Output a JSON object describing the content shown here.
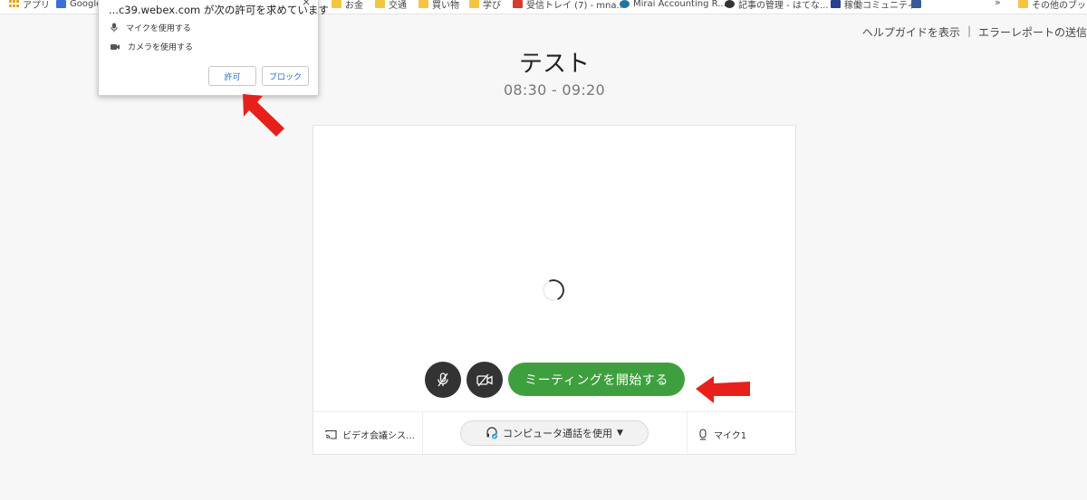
{
  "bookmarks": [
    {
      "label": "アプリ",
      "icon": "apps-icon"
    },
    {
      "label": "Google",
      "icon": "google-icon"
    },
    {
      "label": "お金",
      "icon": "folder-icon"
    },
    {
      "label": "交通",
      "icon": "folder-icon"
    },
    {
      "label": "買い物",
      "icon": "folder-icon"
    },
    {
      "label": "学び",
      "icon": "folder-icon"
    },
    {
      "label": "受信トレイ (7) - mna...",
      "icon": "gmail-icon"
    },
    {
      "label": "Mirai Accounting R...",
      "icon": "wordpress-icon"
    },
    {
      "label": "記事の管理 - はてな...",
      "icon": "hatena-icon"
    },
    {
      "label": "稼働コミュニティ",
      "icon": "site-icon"
    },
    {
      "label": "",
      "icon": "facebook-icon"
    },
    {
      "label": "その他のブックマーク",
      "icon": "folder-icon"
    }
  ],
  "bookmarks_more": "»",
  "help": {
    "guide": "ヘルプガイドを表示",
    "separator": "|",
    "report": "エラーレポートの送信"
  },
  "meeting": {
    "title": "テスト",
    "time": "08:30 - 09:20",
    "start_button": "ミーティングを開始する",
    "video_system": "ビデオ会議シス…",
    "audio_option": "コンピュータ通話を使用",
    "mic": "マイク1"
  },
  "permission_popup": {
    "title": "...c39.webex.com が次の許可を求めています",
    "close": "×",
    "mic_permission": "マイクを使用する",
    "camera_permission": "カメラを使用する",
    "allow": "許可",
    "block": "ブロック"
  },
  "colors": {
    "start_green": "#3e9f3e",
    "annotation_red": "#e8201c",
    "link_blue": "#2a6bd1"
  }
}
